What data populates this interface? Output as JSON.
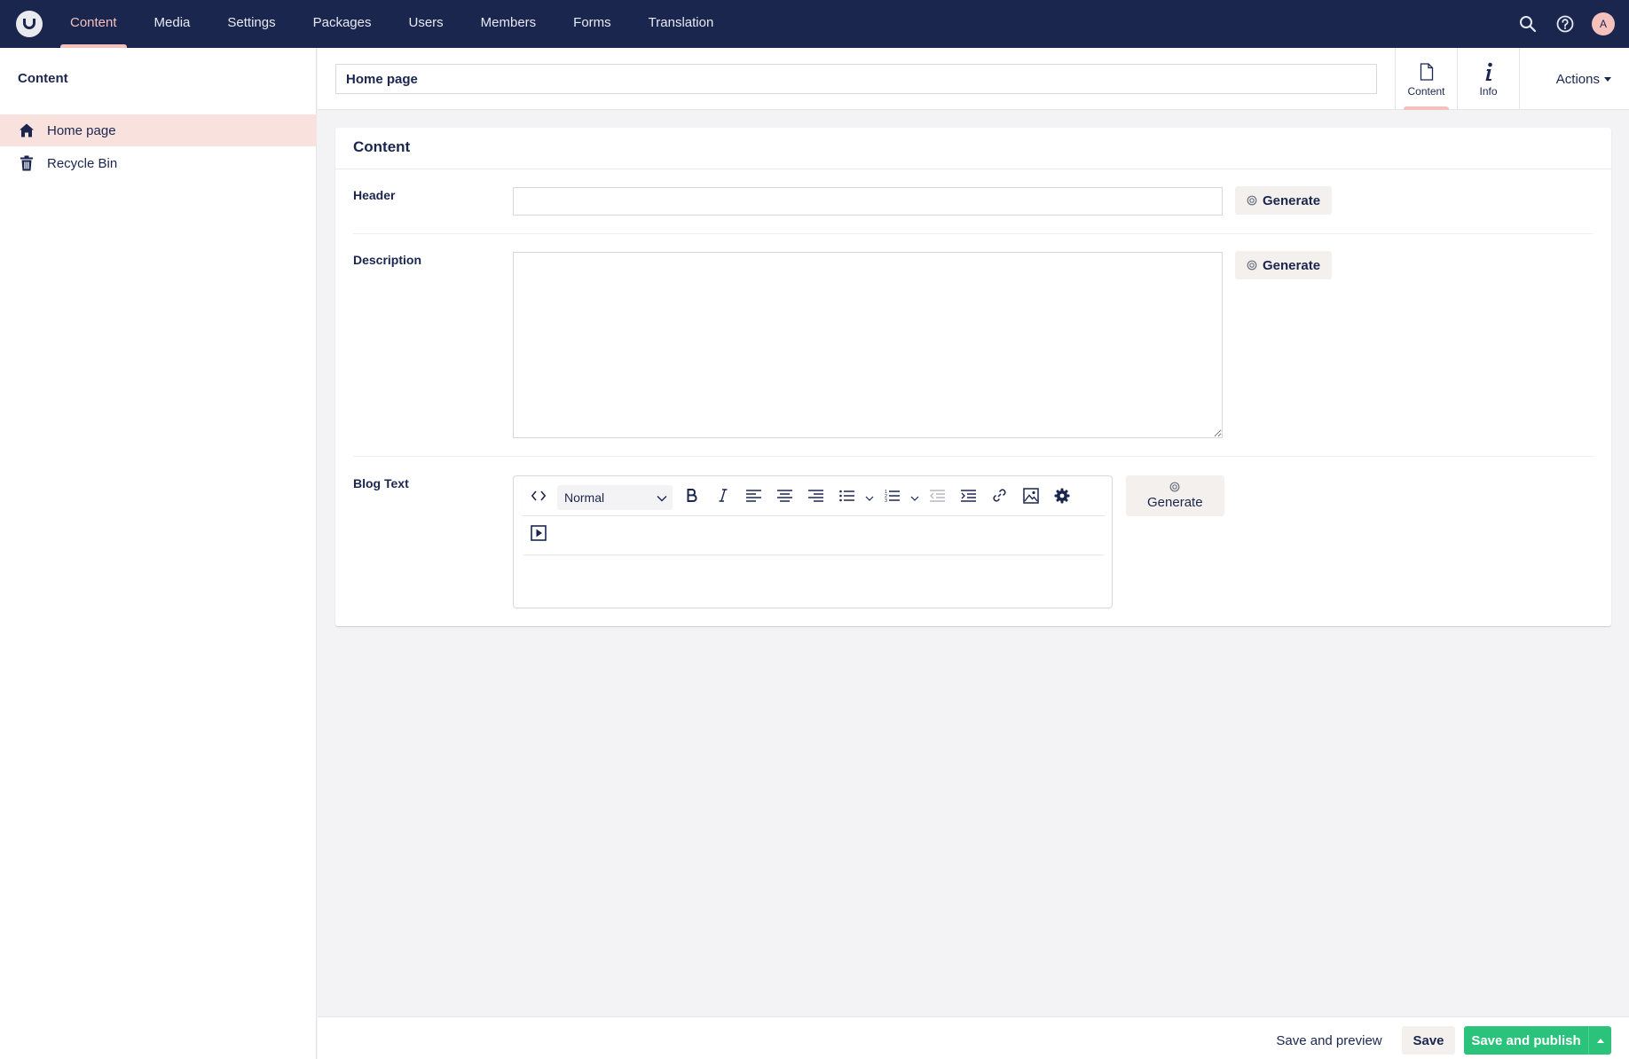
{
  "topbar": {
    "sections": [
      "Content",
      "Media",
      "Settings",
      "Packages",
      "Users",
      "Members",
      "Forms",
      "Translation"
    ],
    "active_section": "Content",
    "avatar_initial": "A"
  },
  "sidebar": {
    "title": "Content",
    "items": [
      {
        "label": "Home page",
        "icon": "home-icon",
        "selected": true
      },
      {
        "label": "Recycle Bin",
        "icon": "trash-icon",
        "selected": false
      }
    ]
  },
  "editor": {
    "node_name": "Home page",
    "tabs": [
      {
        "label": "Content",
        "icon": "document-icon",
        "active": true
      },
      {
        "label": "Info",
        "icon": "info-icon",
        "active": false
      }
    ],
    "actions_label": "Actions"
  },
  "panel": {
    "title": "Content",
    "properties": {
      "header": {
        "label": "Header",
        "value": "",
        "generate_label": "Generate"
      },
      "description": {
        "label": "Description",
        "value": "",
        "generate_label": "Generate"
      },
      "blog_text": {
        "label": "Blog Text",
        "format_selected": "Normal",
        "generate_label": "Generate"
      }
    }
  },
  "footer": {
    "save_preview": "Save and preview",
    "save": "Save",
    "save_publish": "Save and publish"
  },
  "colors": {
    "topbar": "#1b264f",
    "accent": "#f5c1bc",
    "publish": "#2bc37c",
    "selected_item": "#f9e1de"
  }
}
